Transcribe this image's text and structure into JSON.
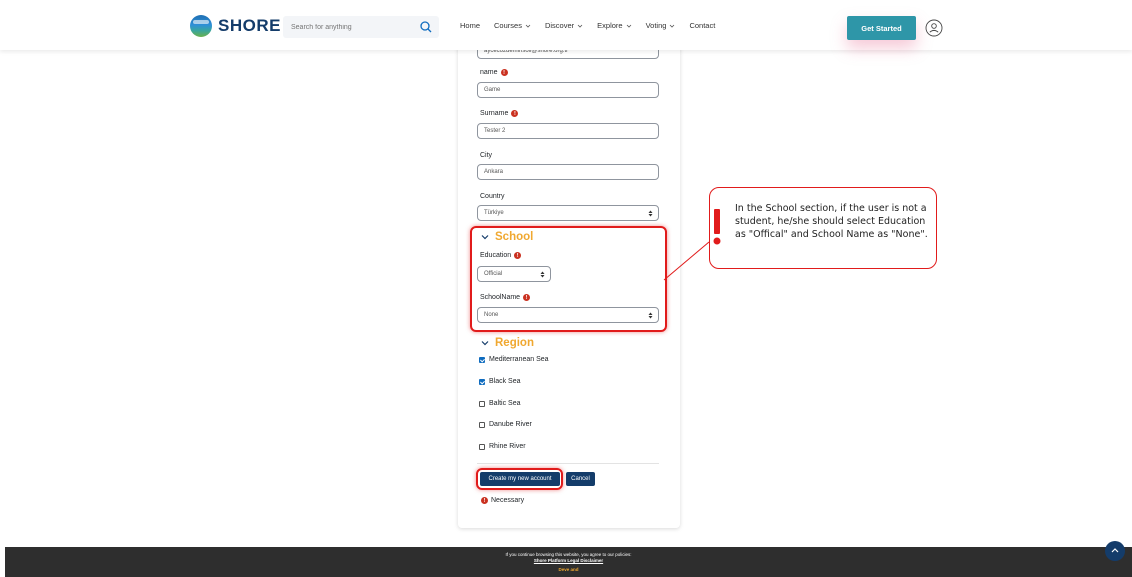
{
  "header": {
    "logo_text": "SHORE",
    "search_placeholder": "Search for anything",
    "nav": [
      {
        "label": "Home",
        "has_dropdown": false
      },
      {
        "label": "Courses",
        "has_dropdown": true
      },
      {
        "label": "Discover",
        "has_dropdown": true
      },
      {
        "label": "Explore",
        "has_dropdown": true
      },
      {
        "label": "Voting",
        "has_dropdown": true
      },
      {
        "label": "Contact",
        "has_dropdown": false
      }
    ],
    "cta_label": "Get Started"
  },
  "form": {
    "email_value": "aycecozdemirisoli@shore.org.tr",
    "name_label": "name",
    "name_value": "Game",
    "surname_label": "Surname",
    "surname_value": "Tester 2",
    "city_label": "City",
    "city_value": "Ankara",
    "country_label": "Country",
    "country_value": "Türkiye",
    "school_section": "School",
    "education_label": "Education",
    "education_value": "Official",
    "schoolname_label": "SchoolName",
    "schoolname_value": "None",
    "region_section": "Region",
    "regions": [
      {
        "label": "Mediterranean Sea",
        "checked": true
      },
      {
        "label": "Black Sea",
        "checked": true
      },
      {
        "label": "Baltic Sea",
        "checked": false
      },
      {
        "label": "Danube River",
        "checked": false
      },
      {
        "label": "Rhine River",
        "checked": false
      }
    ],
    "submit_label": "Create my new account",
    "cancel_label": "Cancel",
    "necessary_label": "Necessary"
  },
  "annotation": {
    "text": "In the School section, if the user is not a student, he/she should select Education as \"Offical\" and School Name as \"None\"."
  },
  "footer": {
    "line1": "If you continue browsing this website, you agree to our policies:",
    "line2": "Shore Platform Legal Disclaimer",
    "line3": "Deve and"
  },
  "colors": {
    "brand_navy": "#143c6a",
    "accent_orange": "#f0a830",
    "cta_teal": "#2e96a8",
    "annotation_red": "#e11b1b",
    "required_red": "#ca3120"
  }
}
